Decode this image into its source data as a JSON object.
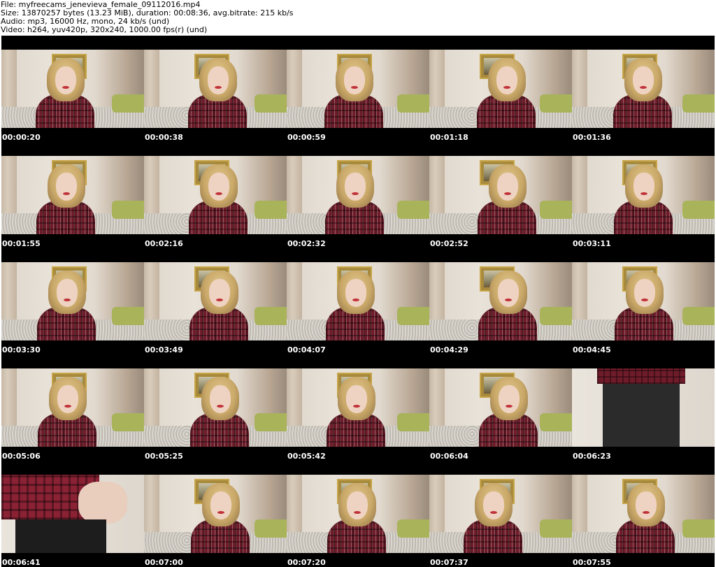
{
  "header": {
    "file": "File: myfreecams_jenevieva_female_09112016.mp4",
    "size": "Size: 13870257 bytes (13.23 MiB), duration: 00:08:36, avg.bitrate: 215 kb/s",
    "audio": "Audio: mp3, 16000 Hz, mono, 24 kb/s (und)",
    "video": "Video: h264, yuv420p, 320x240, 1000.00 fps(r) (und)"
  },
  "thumbnails": [
    {
      "timestamp": "00:00:20"
    },
    {
      "timestamp": "00:00:38"
    },
    {
      "timestamp": "00:00:59"
    },
    {
      "timestamp": "00:01:18"
    },
    {
      "timestamp": "00:01:36"
    },
    {
      "timestamp": "00:01:55"
    },
    {
      "timestamp": "00:02:16"
    },
    {
      "timestamp": "00:02:32"
    },
    {
      "timestamp": "00:02:52"
    },
    {
      "timestamp": "00:03:11"
    },
    {
      "timestamp": "00:03:30"
    },
    {
      "timestamp": "00:03:49"
    },
    {
      "timestamp": "00:04:07"
    },
    {
      "timestamp": "00:04:29"
    },
    {
      "timestamp": "00:04:45"
    },
    {
      "timestamp": "00:05:06"
    },
    {
      "timestamp": "00:05:25"
    },
    {
      "timestamp": "00:05:42"
    },
    {
      "timestamp": "00:06:04"
    },
    {
      "timestamp": "00:06:23"
    },
    {
      "timestamp": "00:06:41"
    },
    {
      "timestamp": "00:07:00"
    },
    {
      "timestamp": "00:07:20"
    },
    {
      "timestamp": "00:07:37"
    },
    {
      "timestamp": "00:07:55"
    }
  ]
}
